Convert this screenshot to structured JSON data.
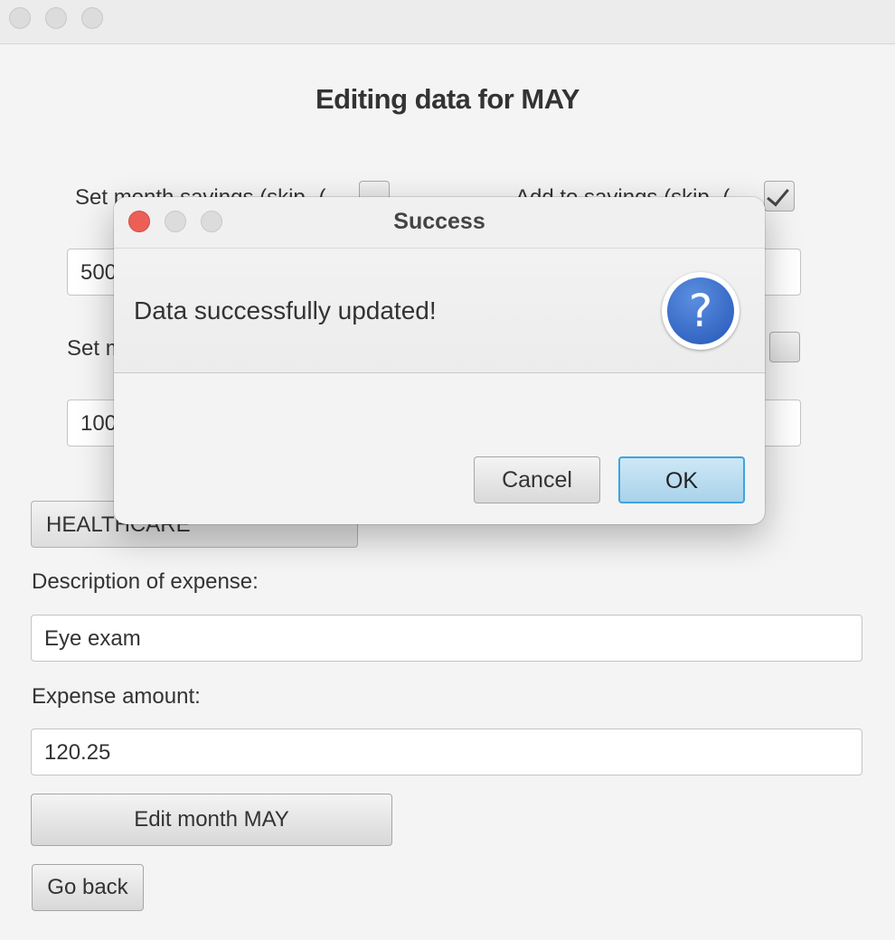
{
  "page": {
    "title": "Editing data for MAY"
  },
  "form": {
    "set_savings_label": "Set month savings (skip -(",
    "add_savings_label": "Add to savings (skip -(",
    "add_savings_checked": true,
    "savings_value": "500",
    "set_second_label": "Set m",
    "second_checked": false,
    "second_value": "100",
    "category_value": "HEALTHCARE",
    "description_label": "Description of expense:",
    "description_value": "Eye exam",
    "amount_label": "Expense amount:",
    "amount_value": "120.25",
    "edit_button_label": "Edit month MAY",
    "back_button_label": "Go back"
  },
  "dialog": {
    "title": "Success",
    "message": "Data successfully updated!",
    "icon": "question-icon",
    "icon_glyph": "?",
    "cancel_label": "Cancel",
    "ok_label": "OK"
  },
  "colors": {
    "close_red": "#ec5f57",
    "ok_blue": "#b9dcef",
    "focus_blue": "#3fa3e0"
  }
}
